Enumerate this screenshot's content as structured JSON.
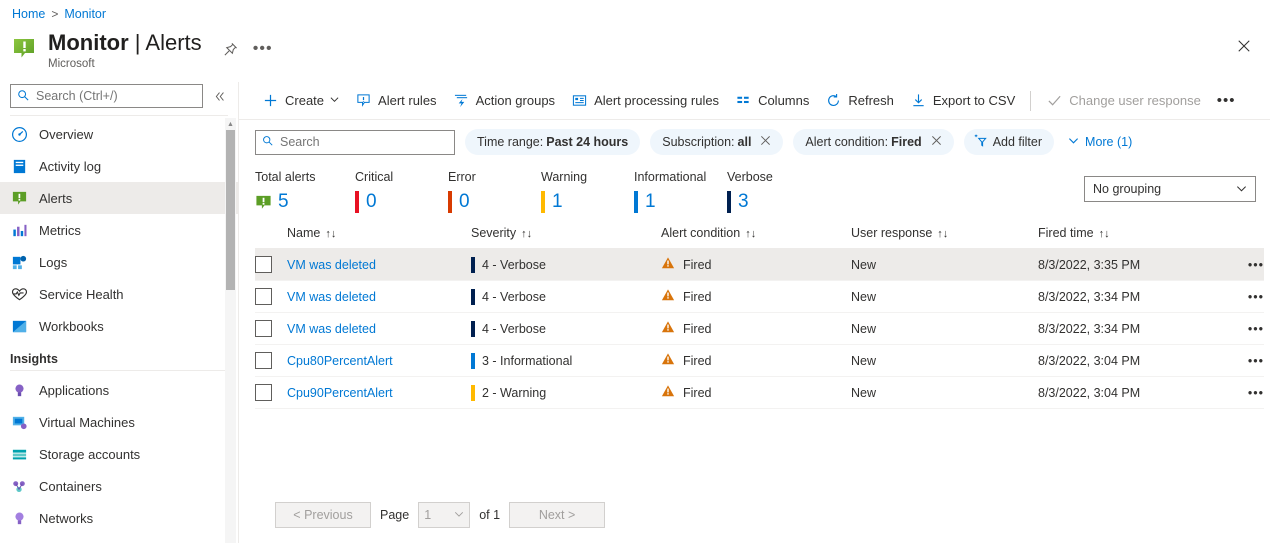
{
  "breadcrumb": {
    "home": "Home",
    "separator": ">",
    "current": "Monitor"
  },
  "header": {
    "title_bold": "Monitor",
    "title_divider": " | ",
    "title_rest": "Alerts",
    "subtitle": "Microsoft",
    "pin_icon": "pin-icon",
    "more_icon": "ellipsis-icon",
    "close_icon": "close-icon",
    "alert_icon": "alert-green-icon"
  },
  "sidebar": {
    "search_placeholder": "Search (Ctrl+/)",
    "search_value": "",
    "collapse_icon": "chevron-double-left-icon",
    "items": [
      {
        "label": "Overview",
        "icon": "overview-icon",
        "selected": false
      },
      {
        "label": "Activity log",
        "icon": "activity-log-icon",
        "selected": false
      },
      {
        "label": "Alerts",
        "icon": "alerts-icon",
        "selected": true
      },
      {
        "label": "Metrics",
        "icon": "metrics-icon",
        "selected": false
      },
      {
        "label": "Logs",
        "icon": "logs-icon",
        "selected": false
      },
      {
        "label": "Service Health",
        "icon": "heart-icon",
        "selected": false
      },
      {
        "label": "Workbooks",
        "icon": "workbooks-icon",
        "selected": false
      }
    ],
    "section_insights": "Insights",
    "insights_items": [
      {
        "label": "Applications",
        "icon": "applications-icon"
      },
      {
        "label": "Virtual Machines",
        "icon": "virtual-machines-icon"
      },
      {
        "label": "Storage accounts",
        "icon": "storage-accounts-icon"
      },
      {
        "label": "Containers",
        "icon": "containers-icon"
      },
      {
        "label": "Networks",
        "icon": "networks-icon"
      }
    ]
  },
  "toolbar": {
    "create_label": "Create",
    "alert_rules_label": "Alert rules",
    "action_groups_label": "Action groups",
    "alert_processing_rules_label": "Alert processing rules",
    "columns_label": "Columns",
    "refresh_label": "Refresh",
    "export_csv_label": "Export to CSV",
    "change_user_response_label": "Change user response",
    "overflow_label": "•••"
  },
  "filters": {
    "search_placeholder": "Search",
    "search_value": "",
    "pills": [
      {
        "name": "Time range",
        "sep": " : ",
        "value": "Past 24 hours",
        "removable": false
      },
      {
        "name": "Subscription",
        "sep": " : ",
        "value": "all",
        "removable": true
      },
      {
        "name": "Alert condition",
        "sep": " : ",
        "value": "Fired",
        "removable": true
      }
    ],
    "add_filter_label": "Add filter",
    "more_label": "More (1)"
  },
  "summary": {
    "cells": [
      {
        "label": "Total alerts",
        "value": "5",
        "color": "",
        "is_total": true
      },
      {
        "label": "Critical",
        "value": "0",
        "color": "#e81123",
        "is_total": false
      },
      {
        "label": "Error",
        "value": "0",
        "color": "#d83b01",
        "is_total": false
      },
      {
        "label": "Warning",
        "value": "1",
        "color": "#ffb900",
        "is_total": false
      },
      {
        "label": "Informational",
        "value": "1",
        "color": "#0078d4",
        "is_total": false
      },
      {
        "label": "Verbose",
        "value": "3",
        "color": "#002050",
        "is_total": false
      }
    ],
    "grouping_value": "No grouping"
  },
  "table": {
    "columns": [
      {
        "label": "Name",
        "sortable": true
      },
      {
        "label": "Severity",
        "sortable": true
      },
      {
        "label": "Alert condition",
        "sortable": true
      },
      {
        "label": "User response",
        "sortable": true
      },
      {
        "label": "Fired time",
        "sortable": true
      }
    ],
    "sort_glyph": "↑↓",
    "rows": [
      {
        "name": "VM was deleted",
        "severity": "4 - Verbose",
        "sev_color": "#002050",
        "condition": "Fired",
        "user_response": "New",
        "fired_time": "8/3/2022, 3:35 PM",
        "selected": true
      },
      {
        "name": "VM was deleted",
        "severity": "4 - Verbose",
        "sev_color": "#002050",
        "condition": "Fired",
        "user_response": "New",
        "fired_time": "8/3/2022, 3:34 PM",
        "selected": false
      },
      {
        "name": "VM was deleted",
        "severity": "4 - Verbose",
        "sev_color": "#002050",
        "condition": "Fired",
        "user_response": "New",
        "fired_time": "8/3/2022, 3:34 PM",
        "selected": false
      },
      {
        "name": "Cpu80PercentAlert",
        "severity": "3 - Informational",
        "sev_color": "#0078d4",
        "condition": "Fired",
        "user_response": "New",
        "fired_time": "8/3/2022, 3:04 PM",
        "selected": false
      },
      {
        "name": "Cpu90PercentAlert",
        "severity": "2 - Warning",
        "sev_color": "#ffb900",
        "condition": "Fired",
        "user_response": "New",
        "fired_time": "8/3/2022, 3:04 PM",
        "selected": false
      }
    ],
    "row_menu_glyph": "•••"
  },
  "pagination": {
    "previous_label": "< Previous",
    "page_label": "Page",
    "page_value": "1",
    "of_label": "of 1",
    "next_label": "Next >"
  },
  "colors": {
    "accent": "#0078d4",
    "pill_bg": "#eff6fc",
    "selected_row": "#edebe9",
    "fired_orange": "#d8740b"
  }
}
